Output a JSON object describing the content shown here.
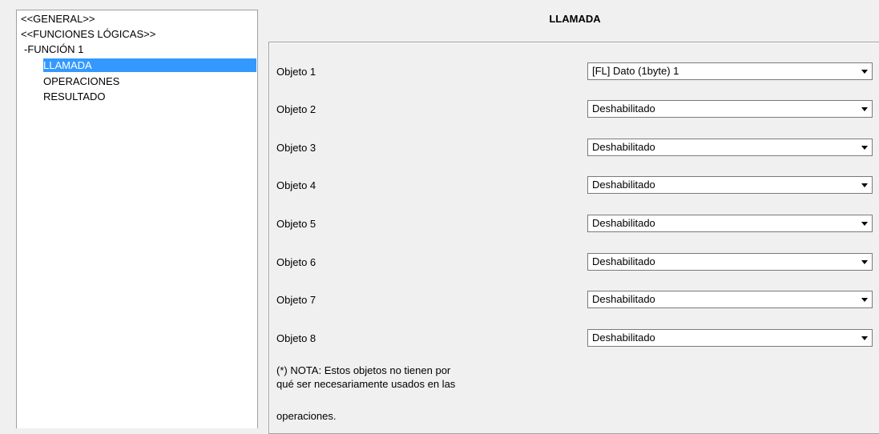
{
  "tree": {
    "items": [
      {
        "label": "<<GENERAL>>"
      },
      {
        "label": "<<FUNCIONES LÓGICAS>>"
      },
      {
        "label": "-FUNCIÓN 1"
      },
      {
        "label": "LLAMADA",
        "selected": true
      },
      {
        "label": "OPERACIONES"
      },
      {
        "label": "RESULTADO"
      }
    ]
  },
  "page": {
    "title": "LLAMADA"
  },
  "objects": [
    {
      "label": "Objeto 1",
      "value": "[FL] Dato (1byte) 1"
    },
    {
      "label": "Objeto 2",
      "value": "Deshabilitado"
    },
    {
      "label": "Objeto 3",
      "value": "Deshabilitado"
    },
    {
      "label": "Objeto 4",
      "value": "Deshabilitado"
    },
    {
      "label": "Objeto 5",
      "value": "Deshabilitado"
    },
    {
      "label": "Objeto 6",
      "value": "Deshabilitado"
    },
    {
      "label": "Objeto 7",
      "value": "Deshabilitado"
    },
    {
      "label": "Objeto 8",
      "value": "Deshabilitado"
    }
  ],
  "note": {
    "line1": "(*) NOTA: Estos objetos no tienen por",
    "line2": "qué ser necesariamente usados en las",
    "line3": "operaciones."
  },
  "colors": {
    "selection": "#3399ff",
    "background": "#f0f0f0"
  }
}
